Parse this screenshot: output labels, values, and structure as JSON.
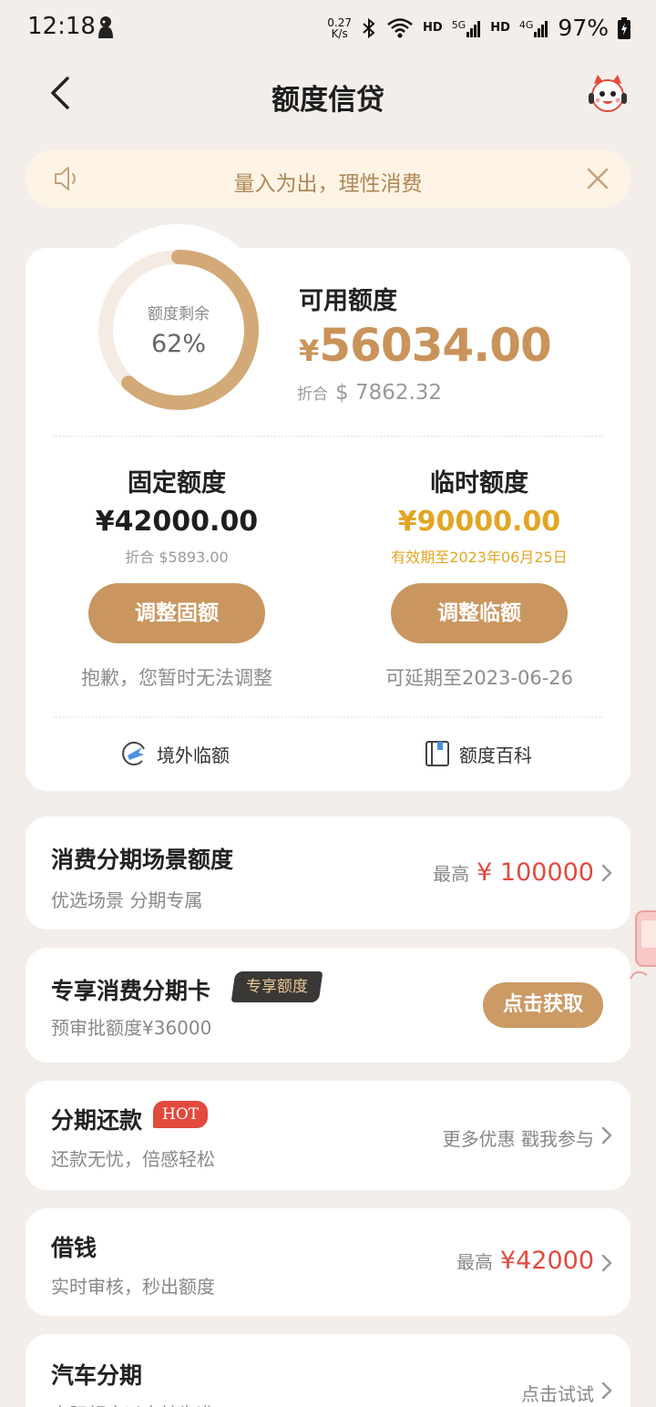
{
  "status_bar": {
    "time": "12:18",
    "net_speed_value": "0.27",
    "net_speed_unit": "K/s",
    "hd1": "HD",
    "sig1": "5G",
    "hd2": "HD",
    "sig2": "4G",
    "battery": "97%"
  },
  "header": {
    "title": "额度信贷"
  },
  "notice": {
    "text": "量入为出，理性消费"
  },
  "credit": {
    "ring_label": "额度剩余",
    "ring_percent_text": "62%",
    "remaining_fraction": 0.62,
    "available_title": "可用额度",
    "available_currency": "¥",
    "available_amount": "56034.00",
    "conversion_prefix": "折合",
    "conversion_value": "$ 7862.32",
    "fixed": {
      "title": "固定额度",
      "amount": "¥42000.00",
      "sub": "折合 $5893.00",
      "button": "调整固额",
      "note": "抱歉，您暂时无法调整"
    },
    "temporary": {
      "title": "临时额度",
      "amount": "¥90000.00",
      "sub": "有效期至2023年06月25日",
      "button": "调整临额",
      "note": "可延期至2023-06-26"
    },
    "link_overseas": "境外临额",
    "link_wiki": "额度百科"
  },
  "list": [
    {
      "title": "消费分期场景额度",
      "sub": "优选场景 分期专属",
      "right_prefix": "最高",
      "right_value": "¥ 100000"
    },
    {
      "title": "专享消费分期卡",
      "tag": "专享额度",
      "sub": "预审批额度¥36000",
      "button": "点击获取"
    },
    {
      "title": "分期还款",
      "tag": "HOT",
      "sub": "还款无忧，倍感轻松",
      "right_prefix": "更多优惠 戳我参与"
    },
    {
      "title": "借钱",
      "sub": "实时审核，秒出额度",
      "right_prefix": "最高",
      "right_value": "¥42000"
    },
    {
      "title": "汽车分期",
      "sub": "实际额度以审核为准",
      "right_prefix": "点击试试"
    }
  ],
  "colors": {
    "background": "#f3eeea",
    "gold": "#c9935a",
    "button": "#c9965f",
    "red": "#e24a3d",
    "amber": "#e2a523"
  }
}
